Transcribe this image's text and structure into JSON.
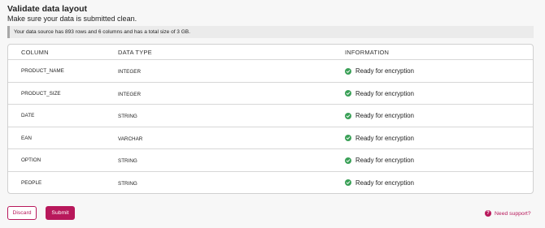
{
  "header": {
    "title": "Validate data layout",
    "subtitle": "Make sure your data is submitted clean."
  },
  "info_bar": {
    "text": "Your data source has 893 rows and 6 columns and has a total size of 3 GB."
  },
  "table": {
    "headers": {
      "column": "COLUMN",
      "data_type": "DATA TYPE",
      "information": "INFORMATION"
    },
    "rows": [
      {
        "name": "PRODUCT_NAME",
        "type": "INTEGER",
        "info": "Ready for encryption",
        "icon": "check-circle-icon"
      },
      {
        "name": "PRODUCT_SIZE",
        "type": "INTEGER",
        "info": "Ready for encryption",
        "icon": "check-circle-icon"
      },
      {
        "name": "DATE",
        "type": "STRING",
        "info": "Ready for encryption",
        "icon": "check-circle-icon"
      },
      {
        "name": "EAN",
        "type": "VARCHAR",
        "info": "Ready for encryption",
        "icon": "check-circle-icon"
      },
      {
        "name": "OPTION",
        "type": "STRING",
        "info": "Ready for encryption",
        "icon": "check-circle-icon"
      },
      {
        "name": "PEOPLE",
        "type": "STRING",
        "info": "Ready for encryption",
        "icon": "check-circle-icon"
      }
    ]
  },
  "actions": {
    "discard_label": "Discard",
    "submit_label": "Submit",
    "support_label": "Need support?",
    "support_icon": "question-circle-icon"
  },
  "colors": {
    "accent": "#b8185b",
    "success": "#3aa057"
  }
}
